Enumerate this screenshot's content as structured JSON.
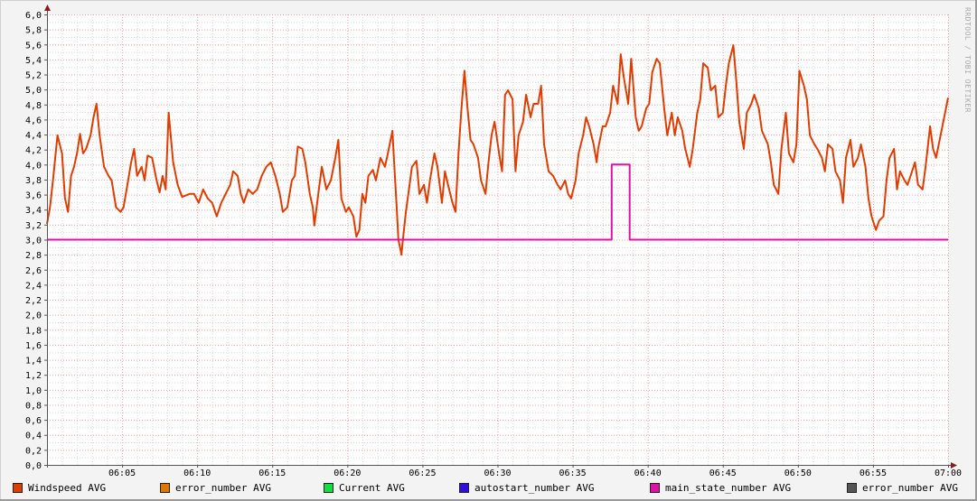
{
  "chart_data": {
    "type": "line",
    "title": "",
    "xlabel": "",
    "ylabel": "",
    "xlim_minutes": [
      0,
      60
    ],
    "ylim": [
      0,
      6.0
    ],
    "y_ticks": [
      "0,0",
      "0,2",
      "0,4",
      "0,6",
      "0,8",
      "1,0",
      "1,2",
      "1,4",
      "1,6",
      "1,8",
      "2,0",
      "2,2",
      "2,4",
      "2,6",
      "2,8",
      "3,0",
      "3,2",
      "3,4",
      "3,6",
      "3,8",
      "4,0",
      "4,2",
      "4,4",
      "4,6",
      "4,8",
      "5,0",
      "5,2",
      "5,4",
      "5,6",
      "5,8",
      "6,0"
    ],
    "x_ticks": [
      {
        "minute": 5,
        "label": "06:05"
      },
      {
        "minute": 10,
        "label": "06:10"
      },
      {
        "minute": 15,
        "label": "06:15"
      },
      {
        "minute": 20,
        "label": "06:20"
      },
      {
        "minute": 25,
        "label": "06:25"
      },
      {
        "minute": 30,
        "label": "06:30"
      },
      {
        "minute": 35,
        "label": "06:35"
      },
      {
        "minute": 40,
        "label": "06:40"
      },
      {
        "minute": 45,
        "label": "06:45"
      },
      {
        "minute": 50,
        "label": "06:50"
      },
      {
        "minute": 55,
        "label": "06:55"
      },
      {
        "minute": 60,
        "label": "07:00"
      }
    ],
    "grid": true,
    "legend_position": "bottom",
    "watermark": "RRDTOOL / TOBI OETIKER",
    "series": [
      {
        "name": "Windspeed AVG",
        "color": "#e03c00",
        "points": [
          [
            0,
            3.21
          ],
          [
            0.2,
            3.43
          ],
          [
            0.4,
            3.79
          ],
          [
            0.7,
            4.39
          ],
          [
            1.0,
            4.15
          ],
          [
            1.2,
            3.55
          ],
          [
            1.4,
            3.37
          ],
          [
            1.6,
            3.85
          ],
          [
            1.8,
            3.97
          ],
          [
            2.0,
            4.15
          ],
          [
            2.2,
            4.41
          ],
          [
            2.4,
            4.15
          ],
          [
            2.6,
            4.21
          ],
          [
            2.9,
            4.39
          ],
          [
            3.1,
            4.63
          ],
          [
            3.3,
            4.81
          ],
          [
            3.5,
            4.39
          ],
          [
            3.8,
            3.97
          ],
          [
            4.1,
            3.85
          ],
          [
            4.3,
            3.79
          ],
          [
            4.6,
            3.43
          ],
          [
            4.9,
            3.37
          ],
          [
            5.1,
            3.43
          ],
          [
            5.3,
            3.67
          ],
          [
            5.6,
            4.03
          ],
          [
            5.8,
            4.21
          ],
          [
            6.0,
            3.85
          ],
          [
            6.3,
            3.97
          ],
          [
            6.5,
            3.79
          ],
          [
            6.7,
            4.12
          ],
          [
            7.0,
            4.09
          ],
          [
            7.3,
            3.79
          ],
          [
            7.5,
            3.63
          ],
          [
            7.7,
            3.85
          ],
          [
            7.9,
            3.67
          ],
          [
            8.1,
            4.69
          ],
          [
            8.4,
            4.03
          ],
          [
            8.7,
            3.73
          ],
          [
            9.0,
            3.57
          ],
          [
            9.5,
            3.61
          ],
          [
            9.8,
            3.61
          ],
          [
            10.1,
            3.49
          ],
          [
            10.4,
            3.67
          ],
          [
            10.7,
            3.55
          ],
          [
            11.0,
            3.49
          ],
          [
            11.3,
            3.31
          ],
          [
            11.6,
            3.49
          ],
          [
            11.9,
            3.61
          ],
          [
            12.2,
            3.73
          ],
          [
            12.4,
            3.91
          ],
          [
            12.7,
            3.85
          ],
          [
            12.9,
            3.61
          ],
          [
            13.1,
            3.49
          ],
          [
            13.4,
            3.67
          ],
          [
            13.7,
            3.61
          ],
          [
            14.0,
            3.67
          ],
          [
            14.3,
            3.85
          ],
          [
            14.6,
            3.97
          ],
          [
            14.9,
            4.03
          ],
          [
            15.2,
            3.85
          ],
          [
            15.5,
            3.61
          ],
          [
            15.7,
            3.37
          ],
          [
            16.0,
            3.43
          ],
          [
            16.3,
            3.79
          ],
          [
            16.5,
            3.85
          ],
          [
            16.7,
            4.24
          ],
          [
            17.0,
            4.21
          ],
          [
            17.2,
            4.03
          ],
          [
            17.5,
            3.61
          ],
          [
            17.7,
            3.43
          ],
          [
            17.8,
            3.19
          ],
          [
            18.1,
            3.67
          ],
          [
            18.3,
            3.97
          ],
          [
            18.6,
            3.67
          ],
          [
            18.9,
            3.79
          ],
          [
            19.2,
            4.09
          ],
          [
            19.4,
            4.33
          ],
          [
            19.6,
            3.55
          ],
          [
            19.9,
            3.37
          ],
          [
            20.1,
            3.43
          ],
          [
            20.4,
            3.31
          ],
          [
            20.6,
            3.04
          ],
          [
            20.8,
            3.13
          ],
          [
            21.0,
            3.61
          ],
          [
            21.2,
            3.49
          ],
          [
            21.4,
            3.85
          ],
          [
            21.7,
            3.93
          ],
          [
            21.9,
            3.79
          ],
          [
            22.2,
            4.09
          ],
          [
            22.5,
            3.97
          ],
          [
            22.7,
            4.15
          ],
          [
            23.0,
            4.45
          ],
          [
            23.1,
            4.09
          ],
          [
            23.3,
            3.37
          ],
          [
            23.4,
            3.0
          ],
          [
            23.6,
            2.8
          ],
          [
            23.7,
            3.0
          ],
          [
            23.9,
            3.37
          ],
          [
            24.1,
            3.67
          ],
          [
            24.3,
            3.97
          ],
          [
            24.6,
            4.05
          ],
          [
            24.8,
            3.61
          ],
          [
            25.1,
            3.73
          ],
          [
            25.3,
            3.49
          ],
          [
            25.5,
            3.79
          ],
          [
            25.8,
            4.15
          ],
          [
            26.0,
            3.97
          ],
          [
            26.3,
            3.49
          ],
          [
            26.5,
            3.91
          ],
          [
            26.7,
            3.73
          ],
          [
            27.0,
            3.49
          ],
          [
            27.2,
            3.37
          ],
          [
            27.4,
            4.15
          ],
          [
            27.6,
            4.75
          ],
          [
            27.8,
            5.25
          ],
          [
            28.0,
            4.75
          ],
          [
            28.2,
            4.33
          ],
          [
            28.4,
            4.27
          ],
          [
            28.7,
            4.09
          ],
          [
            28.9,
            3.79
          ],
          [
            29.2,
            3.61
          ],
          [
            29.4,
            4.03
          ],
          [
            29.6,
            4.39
          ],
          [
            29.8,
            4.57
          ],
          [
            30.1,
            4.15
          ],
          [
            30.3,
            3.91
          ],
          [
            30.5,
            4.93
          ],
          [
            30.7,
            4.99
          ],
          [
            31.0,
            4.87
          ],
          [
            31.2,
            3.91
          ],
          [
            31.4,
            4.39
          ],
          [
            31.7,
            4.57
          ],
          [
            31.9,
            4.93
          ],
          [
            32.2,
            4.63
          ],
          [
            32.4,
            4.81
          ],
          [
            32.7,
            4.81
          ],
          [
            32.9,
            5.05
          ],
          [
            33.1,
            4.27
          ],
          [
            33.4,
            3.91
          ],
          [
            33.7,
            3.85
          ],
          [
            34.0,
            3.73
          ],
          [
            34.2,
            3.67
          ],
          [
            34.5,
            3.79
          ],
          [
            34.7,
            3.61
          ],
          [
            34.9,
            3.55
          ],
          [
            35.2,
            3.79
          ],
          [
            35.4,
            4.15
          ],
          [
            35.7,
            4.39
          ],
          [
            35.9,
            4.63
          ],
          [
            36.1,
            4.51
          ],
          [
            36.4,
            4.27
          ],
          [
            36.6,
            4.03
          ],
          [
            36.7,
            4.21
          ],
          [
            37.0,
            4.51
          ],
          [
            37.2,
            4.51
          ],
          [
            37.5,
            4.69
          ],
          [
            37.7,
            5.05
          ],
          [
            38.0,
            4.81
          ],
          [
            38.2,
            5.47
          ],
          [
            38.4,
            5.17
          ],
          [
            38.7,
            4.81
          ],
          [
            38.9,
            5.41
          ],
          [
            39.2,
            4.63
          ],
          [
            39.4,
            4.45
          ],
          [
            39.6,
            4.51
          ],
          [
            39.9,
            4.75
          ],
          [
            40.1,
            4.81
          ],
          [
            40.3,
            5.23
          ],
          [
            40.6,
            5.41
          ],
          [
            40.8,
            5.35
          ],
          [
            41.1,
            4.75
          ],
          [
            41.3,
            4.39
          ],
          [
            41.6,
            4.69
          ],
          [
            41.8,
            4.39
          ],
          [
            42.0,
            4.63
          ],
          [
            42.3,
            4.45
          ],
          [
            42.5,
            4.21
          ],
          [
            42.8,
            3.97
          ],
          [
            43.0,
            4.21
          ],
          [
            43.3,
            4.69
          ],
          [
            43.5,
            4.87
          ],
          [
            43.7,
            5.35
          ],
          [
            44.0,
            5.29
          ],
          [
            44.2,
            4.99
          ],
          [
            44.5,
            5.05
          ],
          [
            44.7,
            4.63
          ],
          [
            45.0,
            4.69
          ],
          [
            45.2,
            5.05
          ],
          [
            45.4,
            5.35
          ],
          [
            45.7,
            5.59
          ],
          [
            45.9,
            5.11
          ],
          [
            46.1,
            4.57
          ],
          [
            46.4,
            4.21
          ],
          [
            46.6,
            4.69
          ],
          [
            46.9,
            4.81
          ],
          [
            47.1,
            4.93
          ],
          [
            47.4,
            4.75
          ],
          [
            47.6,
            4.45
          ],
          [
            48.0,
            4.27
          ],
          [
            48.2,
            4.03
          ],
          [
            48.4,
            3.73
          ],
          [
            48.7,
            3.61
          ],
          [
            48.9,
            4.21
          ],
          [
            49.2,
            4.69
          ],
          [
            49.4,
            4.15
          ],
          [
            49.7,
            4.03
          ],
          [
            49.9,
            4.27
          ],
          [
            50.1,
            5.25
          ],
          [
            50.4,
            5.05
          ],
          [
            50.6,
            4.87
          ],
          [
            50.8,
            4.39
          ],
          [
            51.1,
            4.27
          ],
          [
            51.3,
            4.21
          ],
          [
            51.6,
            4.09
          ],
          [
            51.8,
            3.91
          ],
          [
            52.0,
            4.27
          ],
          [
            52.3,
            4.21
          ],
          [
            52.5,
            3.91
          ],
          [
            52.8,
            3.79
          ],
          [
            53.0,
            3.49
          ],
          [
            53.2,
            4.09
          ],
          [
            53.5,
            4.33
          ],
          [
            53.7,
            3.97
          ],
          [
            54.0,
            4.09
          ],
          [
            54.2,
            4.27
          ],
          [
            54.5,
            3.97
          ],
          [
            54.7,
            3.55
          ],
          [
            54.9,
            3.31
          ],
          [
            55.2,
            3.13
          ],
          [
            55.4,
            3.25
          ],
          [
            55.7,
            3.31
          ],
          [
            55.9,
            3.79
          ],
          [
            56.1,
            4.09
          ],
          [
            56.4,
            4.21
          ],
          [
            56.6,
            3.67
          ],
          [
            56.8,
            3.91
          ],
          [
            57.1,
            3.79
          ],
          [
            57.3,
            3.73
          ],
          [
            57.5,
            3.85
          ],
          [
            57.8,
            4.03
          ],
          [
            58.0,
            3.73
          ],
          [
            58.3,
            3.67
          ],
          [
            58.5,
            3.97
          ],
          [
            58.8,
            4.51
          ],
          [
            59.0,
            4.21
          ],
          [
            59.2,
            4.09
          ],
          [
            59.5,
            4.39
          ],
          [
            59.8,
            4.69
          ],
          [
            60.0,
            4.89
          ]
        ]
      },
      {
        "name": "error_number AVG",
        "color": "#e07800",
        "points": []
      },
      {
        "name": "Current AVG",
        "color": "#10e040",
        "points": []
      },
      {
        "name": "autostart_number AVG",
        "color": "#3010e0",
        "points": []
      },
      {
        "name": "main_state_number AVG",
        "color": "#e010a8",
        "points": [
          [
            0,
            3.0
          ],
          [
            37.6,
            3.0
          ],
          [
            37.6,
            4.0
          ],
          [
            38.8,
            4.0
          ],
          [
            38.8,
            3.0
          ],
          [
            60,
            3.0
          ]
        ]
      },
      {
        "name": "error_number AVG",
        "color": "#555555",
        "points": []
      }
    ]
  }
}
